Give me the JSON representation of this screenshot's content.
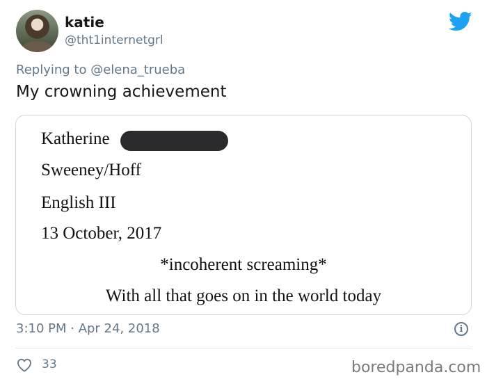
{
  "author": {
    "name": "katie",
    "handle": "@tht1internetgrl"
  },
  "reply": {
    "prefix": "Replying to",
    "mention": "@elena_trueba"
  },
  "tweet": {
    "text": "My crowning achievement",
    "timestamp": "3:10 PM · Apr 24, 2018",
    "likes": "33"
  },
  "media": {
    "lines": [
      "Katherine",
      "Sweeney/Hoff",
      "English III",
      "13 October, 2017",
      "*incoherent screaming*",
      "With all that goes on in the world today"
    ]
  },
  "icons": {
    "brand": "twitter-bird-icon",
    "info": "info-icon",
    "like": "heart-icon"
  },
  "colors": {
    "brand": "#1da1f2",
    "secondary_text": "#657786",
    "border": "#ccd6dd"
  },
  "watermark": "boredpanda.com"
}
